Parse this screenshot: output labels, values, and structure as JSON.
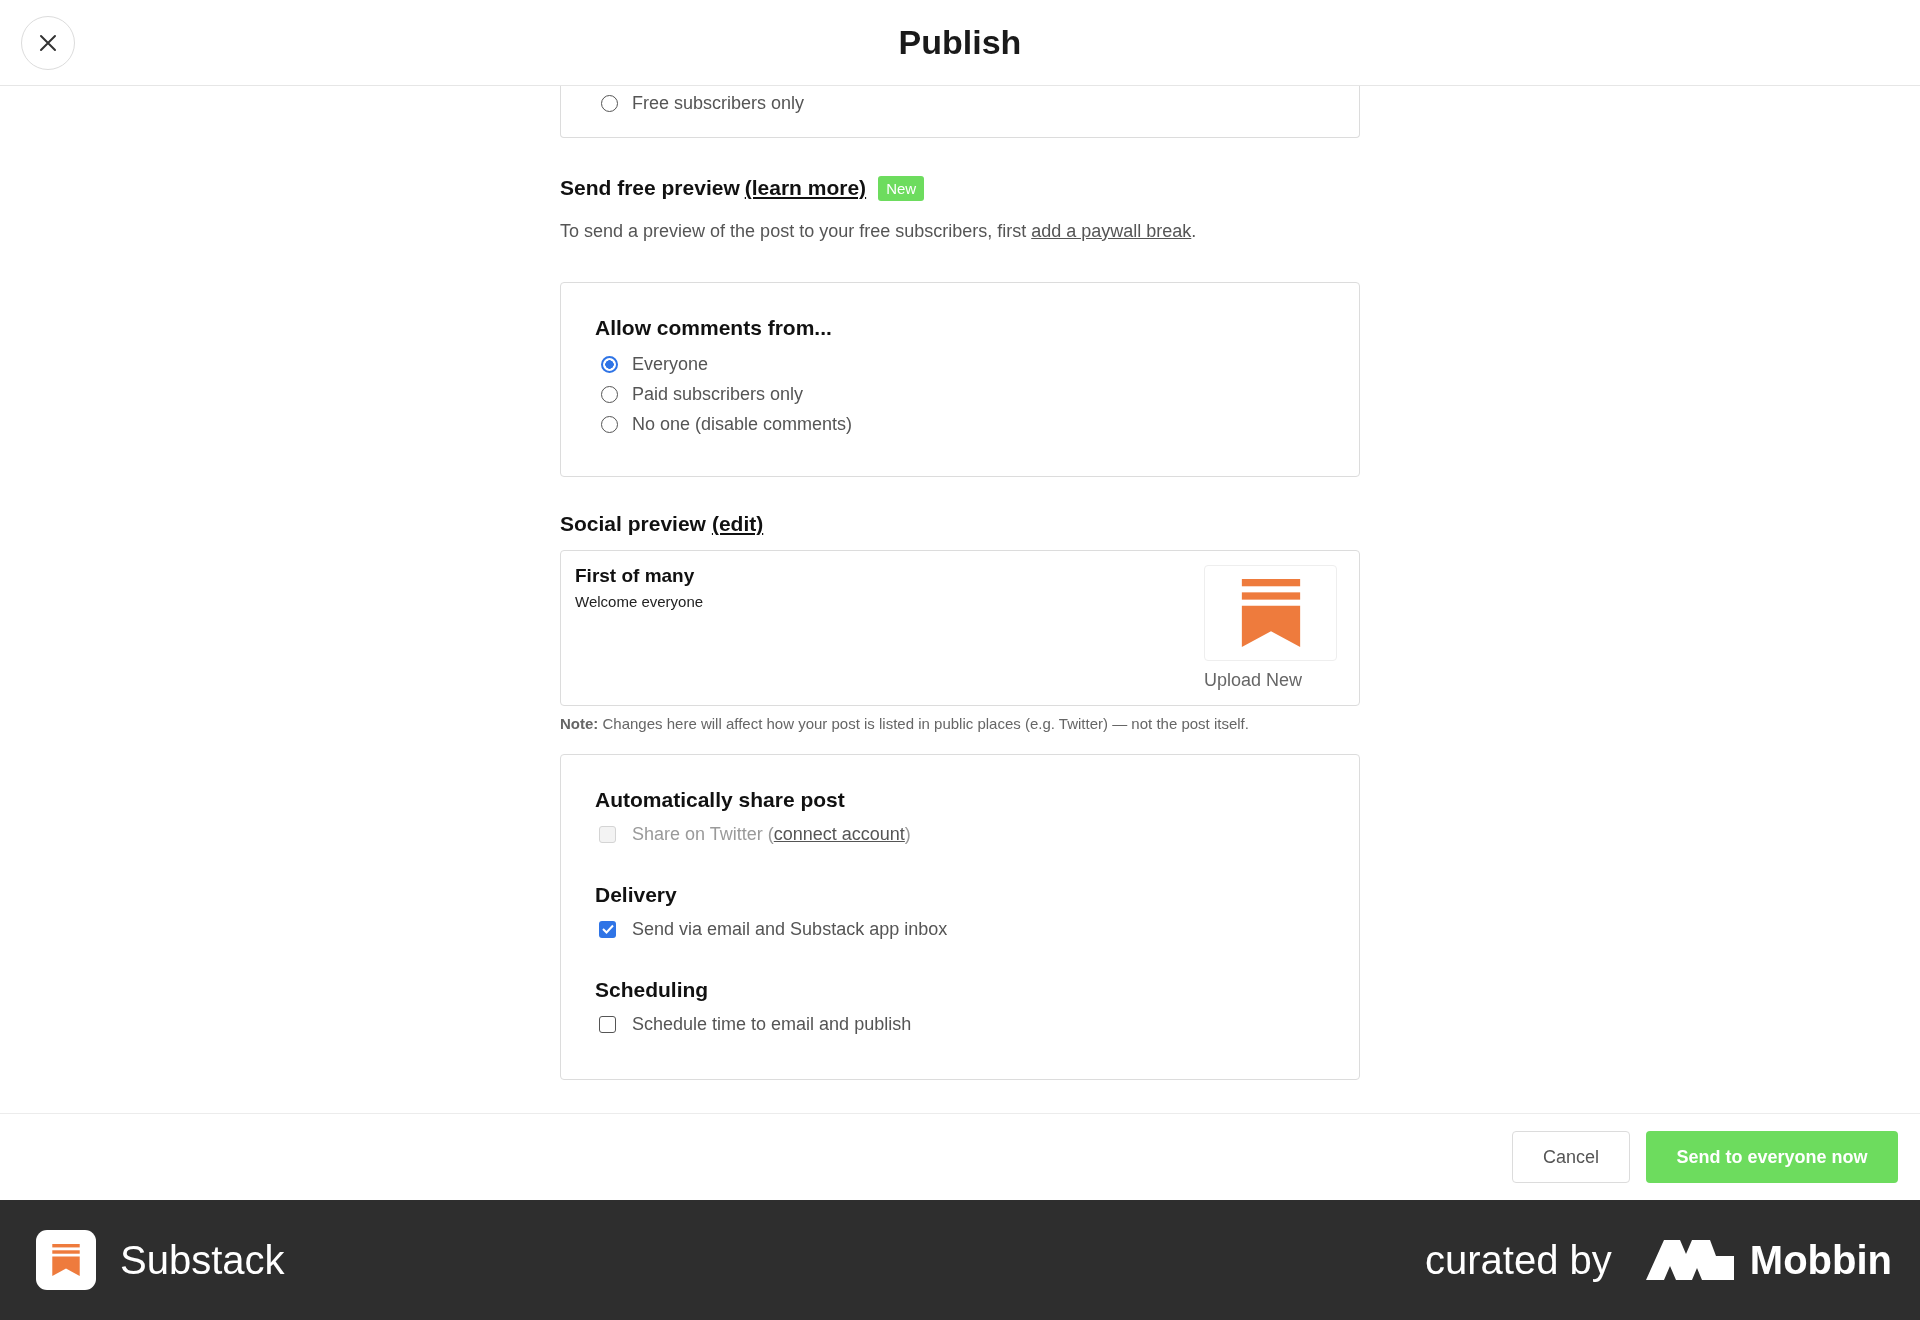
{
  "header": {
    "title": "Publish"
  },
  "audience": {
    "options": [
      {
        "label": "Free subscribers only",
        "selected": false
      }
    ]
  },
  "free_preview": {
    "title": "Send free preview",
    "link": "(learn more)",
    "badge": "New",
    "text_before": "To send a preview of the post to your free subscribers, first ",
    "text_link": "add a paywall break",
    "text_after": "."
  },
  "comments": {
    "title": "Allow comments from...",
    "options": [
      {
        "label": "Everyone",
        "selected": true
      },
      {
        "label": "Paid subscribers only",
        "selected": false
      },
      {
        "label": "No one (disable comments)",
        "selected": false
      }
    ]
  },
  "social_preview": {
    "title": "Social preview",
    "link": "(edit)",
    "post_title": "First of many",
    "post_subtitle": "Welcome everyone",
    "upload_label": "Upload New",
    "note_label": "Note:",
    "note_text": " Changes here will affect how your post is listed in public places (e.g. Twitter) — not the post itself."
  },
  "settings": [
    {
      "title": "Automatically share post",
      "option": {
        "label": "Share on Twitter",
        "link_prefix": " (",
        "link": "connect account",
        "link_suffix": ")",
        "checked": false,
        "disabled": true
      }
    },
    {
      "title": "Delivery",
      "option": {
        "label": "Send via email and Substack app inbox",
        "checked": true,
        "disabled": false
      }
    },
    {
      "title": "Scheduling",
      "option": {
        "label": "Schedule time to email and publish",
        "checked": false,
        "disabled": false
      }
    }
  ],
  "actions": {
    "cancel": "Cancel",
    "confirm": "Send to everyone now"
  },
  "branding": {
    "app_name": "Substack",
    "curated_by": "curated by",
    "curator": "Mobbin"
  }
}
